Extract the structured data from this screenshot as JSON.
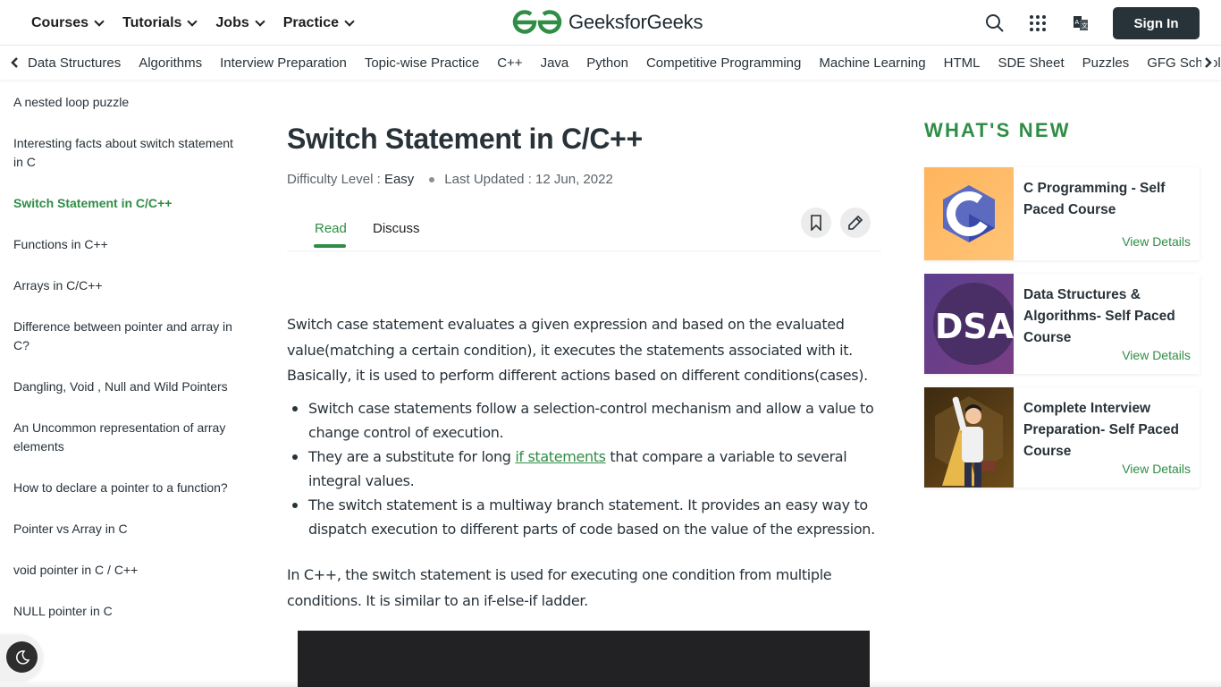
{
  "header": {
    "nav": [
      {
        "label": "Courses"
      },
      {
        "label": "Tutorials"
      },
      {
        "label": "Jobs"
      },
      {
        "label": "Practice"
      }
    ],
    "logo_text": "GeeksforGeeks",
    "sign_in_label": "Sign In",
    "icons": [
      "search-icon",
      "apps-grid-icon",
      "translate-icon"
    ]
  },
  "subnav": {
    "items": [
      "Data Structures",
      "Algorithms",
      "Interview Preparation",
      "Topic-wise Practice",
      "C++",
      "Java",
      "Python",
      "Competitive Programming",
      "Machine Learning",
      "HTML",
      "SDE Sheet",
      "Puzzles",
      "GFG School"
    ]
  },
  "sidebar": {
    "items": [
      {
        "label": "A nested loop puzzle",
        "active": false
      },
      {
        "label": "Interesting facts about switch statement in C",
        "active": false
      },
      {
        "label": "Switch Statement in C/C++",
        "active": true
      },
      {
        "label": "Functions in C++",
        "active": false
      },
      {
        "label": "Arrays in C/C++",
        "active": false
      },
      {
        "label": "Difference between pointer and array in C?",
        "active": false
      },
      {
        "label": "Dangling, Void , Null and Wild Pointers",
        "active": false
      },
      {
        "label": "An Uncommon representation of array elements",
        "active": false
      },
      {
        "label": "How to declare a pointer to a function?",
        "active": false
      },
      {
        "label": "Pointer vs Array in C",
        "active": false
      },
      {
        "label": "void pointer in C / C++",
        "active": false
      },
      {
        "label": "NULL pointer in C",
        "active": false
      }
    ]
  },
  "article": {
    "title": "Switch Statement in C/C++",
    "difficulty_label": "Difficulty Level :",
    "difficulty_value": "Easy",
    "updated_label": "Last Updated :",
    "updated_value": "12 Jun, 2022",
    "tabs": {
      "read": "Read",
      "discuss": "Discuss"
    },
    "para1": "Switch case statement evaluates a given expression and based on the evaluated value(matching a certain condition), it executes the statements associated with it. Basically, it is used to perform different actions based on different conditions(cases).",
    "bullets": {
      "b1": "Switch case statements follow a selection-control mechanism and allow a value to change control of execution.",
      "b2_pre": "They are a substitute for long ",
      "b2_link": "if statements",
      "b2_post": " that compare a variable to several integral values.",
      "b3": "The switch statement is a multiway branch statement. It provides an easy way to dispatch execution to different parts of code based on the value of the expression."
    },
    "para2": "In C++, the switch statement is used for executing one condition from multiple conditions. It is similar to an if-else-if ladder."
  },
  "whats_new": {
    "heading": "WHAT'S NEW",
    "cards": [
      {
        "title": "C Programming - Self Paced Course",
        "link": "View Details",
        "thumb": "C"
      },
      {
        "title": "Data Structures & Algorithms- Self Paced Course",
        "link": "View Details",
        "thumb": "DSA"
      },
      {
        "title": "Complete Interview Preparation- Self Paced Course",
        "link": "View Details",
        "thumb": ""
      }
    ]
  },
  "colors": {
    "brand_green": "#2f8d46",
    "text_dark": "#273239",
    "code_bg": "#222224"
  }
}
